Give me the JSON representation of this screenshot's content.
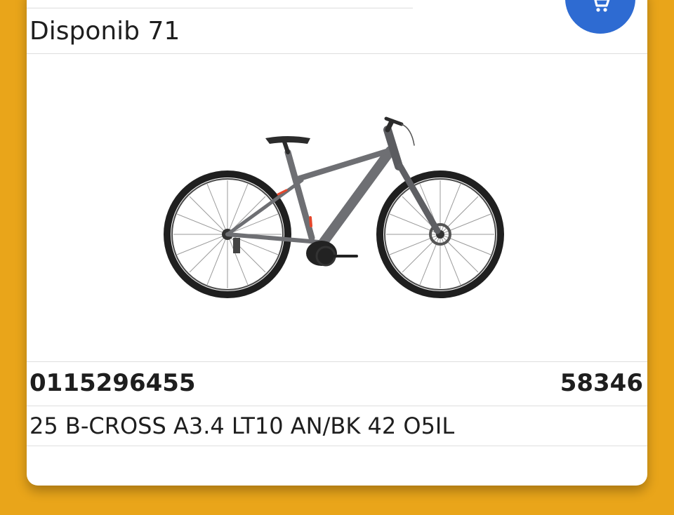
{
  "product": {
    "availability": "Disponib 71",
    "code": "0115296455",
    "price": "58346",
    "description": "25 B-CROSS A3.4 LT10 AN/BK 42 O5IL"
  },
  "cart_button": {
    "icon": "cart-icon"
  },
  "colors": {
    "background": "#E9A51A",
    "card": "#FFFFFF",
    "cart_button": "#2E6BD2",
    "bike_frame": "#6E6F73",
    "bike_accent": "#E5462B"
  }
}
